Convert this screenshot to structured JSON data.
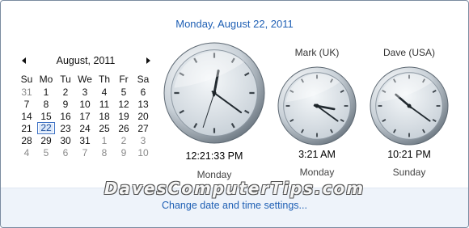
{
  "header": {
    "full_date": "Monday, August 22, 2011"
  },
  "calendar": {
    "month_label": "August, 2011",
    "weekdays": [
      "Su",
      "Mo",
      "Tu",
      "We",
      "Th",
      "Fr",
      "Sa"
    ],
    "today": 22,
    "weeks": [
      [
        {
          "d": "31",
          "o": true
        },
        {
          "d": "1"
        },
        {
          "d": "2"
        },
        {
          "d": "3"
        },
        {
          "d": "4"
        },
        {
          "d": "5"
        },
        {
          "d": "6"
        }
      ],
      [
        {
          "d": "7"
        },
        {
          "d": "8"
        },
        {
          "d": "9"
        },
        {
          "d": "10"
        },
        {
          "d": "11"
        },
        {
          "d": "12"
        },
        {
          "d": "13"
        }
      ],
      [
        {
          "d": "14"
        },
        {
          "d": "15"
        },
        {
          "d": "16"
        },
        {
          "d": "17"
        },
        {
          "d": "18"
        },
        {
          "d": "19"
        },
        {
          "d": "20"
        }
      ],
      [
        {
          "d": "21"
        },
        {
          "d": "22",
          "today": true
        },
        {
          "d": "23"
        },
        {
          "d": "24"
        },
        {
          "d": "25"
        },
        {
          "d": "26"
        },
        {
          "d": "27"
        }
      ],
      [
        {
          "d": "28"
        },
        {
          "d": "29"
        },
        {
          "d": "30"
        },
        {
          "d": "31"
        },
        {
          "d": "1",
          "o": true
        },
        {
          "d": "2",
          "o": true
        },
        {
          "d": "3",
          "o": true
        }
      ],
      [
        {
          "d": "4",
          "o": true
        },
        {
          "d": "5",
          "o": true
        },
        {
          "d": "6",
          "o": true
        },
        {
          "d": "7",
          "o": true
        },
        {
          "d": "8",
          "o": true
        },
        {
          "d": "9",
          "o": true
        },
        {
          "d": "10",
          "o": true
        }
      ]
    ]
  },
  "clocks": {
    "local": {
      "time_label": "12:21:33 PM",
      "day": "Monday",
      "hour": 12,
      "minute": 21,
      "second": 33
    },
    "uk": {
      "name": "Mark (UK)",
      "time_label": "3:21 AM",
      "day": "Monday",
      "hour": 3,
      "minute": 21
    },
    "usa": {
      "name": "Dave (USA)",
      "time_label": "10:21 PM",
      "day": "Sunday",
      "hour": 10,
      "minute": 21
    }
  },
  "footer": {
    "watermark": "DavesComputerTips.com",
    "link_label": "Change date and time settings..."
  },
  "colors": {
    "link": "#1e5fb4",
    "today_border": "#3e72c5",
    "footer_bg": "#eef3fa"
  }
}
